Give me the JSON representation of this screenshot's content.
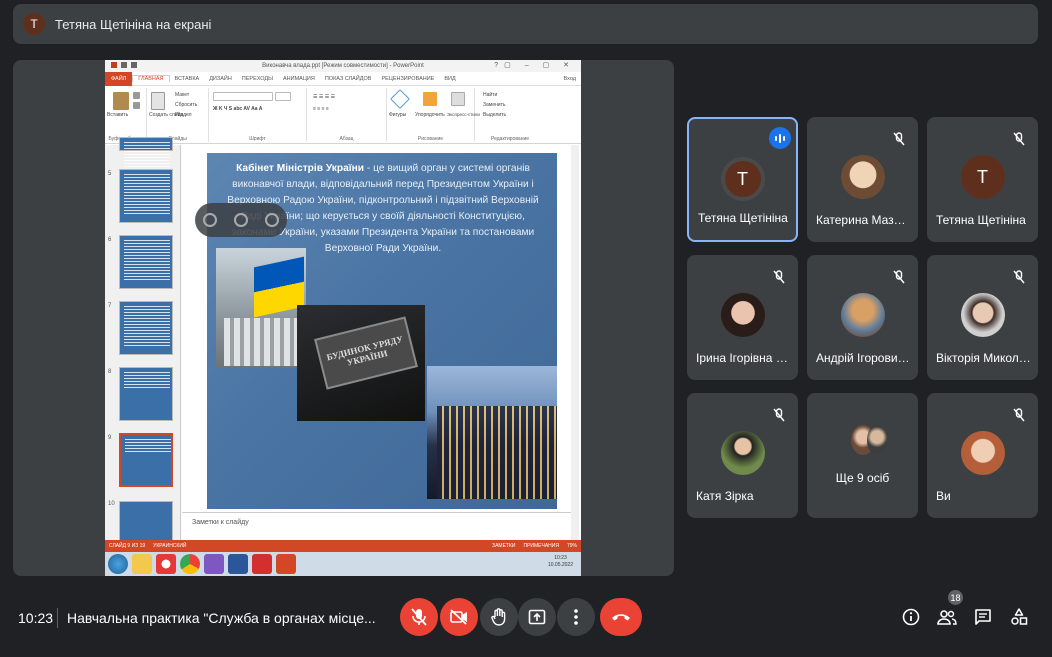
{
  "presenting_banner": {
    "avatar_letter": "Т",
    "text": "Тетяна Щетініна на екрані"
  },
  "powerpoint": {
    "window_title": "Виконавча влада.ppt [Режим совместимости] - PowerPoint",
    "tabs": [
      "ФАЙЛ",
      "ГЛАВНАЯ",
      "ВСТАВКА",
      "ДИЗАЙН",
      "ПЕРЕХОДЫ",
      "АНИМАЦИЯ",
      "ПОКАЗ СЛАЙДОВ",
      "РЕЦЕНЗИРОВАНИЕ",
      "ВИД"
    ],
    "signin": "Вход",
    "ribbon": {
      "paste": "Вставить",
      "new_slide": "Создать слайд",
      "layout": "Макет",
      "reset": "Сбросить",
      "section": "Раздел",
      "shapes": "Фигуры",
      "arrange": "Упорядочить",
      "quick_styles": "Экспресс-стили",
      "find": "Найти",
      "replace": "Заменить",
      "select": "Выделить",
      "groups": [
        "Буфер обмена",
        "Слайды",
        "Шрифт",
        "Абзац",
        "Рисование",
        "Редактирование"
      ]
    },
    "thumbnails": [
      "5",
      "6",
      "7",
      "8",
      "9",
      "10"
    ],
    "slide_text": {
      "bold": "Кабінет Міністрів України",
      "rest": " - це вищий орган у системі органів виконавчої влади, відповідальний перед Президентом України і Верховною Радою України, підконтрольний і підзвітний Верховній Раді України; що керується у своїй діяльності Конституцією, законами України, указами Президента України та постановами Верховної Ради України."
    },
    "sign_text": "БУДИНОК УРЯДУ УКРАЇНИ",
    "notes_placeholder": "Заметки к слайду",
    "status": {
      "slide": "СЛАЙД 9 ИЗ 19",
      "lang": "УКРАИНСКИЙ",
      "notes": "ЗАМЕТКИ",
      "comments": "ПРИМЕЧАНИЯ",
      "zoom": "79%"
    },
    "taskbar_clock": {
      "time": "10:23",
      "date": "10.05.2022",
      "lang": "UK"
    }
  },
  "participants": [
    {
      "name": "Тетяна Щетініна",
      "letter": "Т",
      "speaking": true
    },
    {
      "name": "Катерина Мазни...",
      "letter": "",
      "speaking": false
    },
    {
      "name": "Тетяна Щетініна",
      "letter": "Т",
      "speaking": false
    },
    {
      "name": "Ірина Ігорівна Ж...",
      "letter": "",
      "speaking": false
    },
    {
      "name": "Андрій Ігорович...",
      "letter": "",
      "speaking": false
    },
    {
      "name": "Вікторія Микола...",
      "letter": "",
      "speaking": false
    },
    {
      "name": "Катя Зірка",
      "letter": "",
      "speaking": false
    },
    {
      "name": "Ще 9 осіб",
      "letter": "",
      "speaking": false
    },
    {
      "name": "Ви",
      "letter": "",
      "speaking": false
    }
  ],
  "bottom_bar": {
    "time": "10:23",
    "meeting_title": "Навчальна практика \"Служба в органах місце...",
    "participant_count": "18"
  }
}
